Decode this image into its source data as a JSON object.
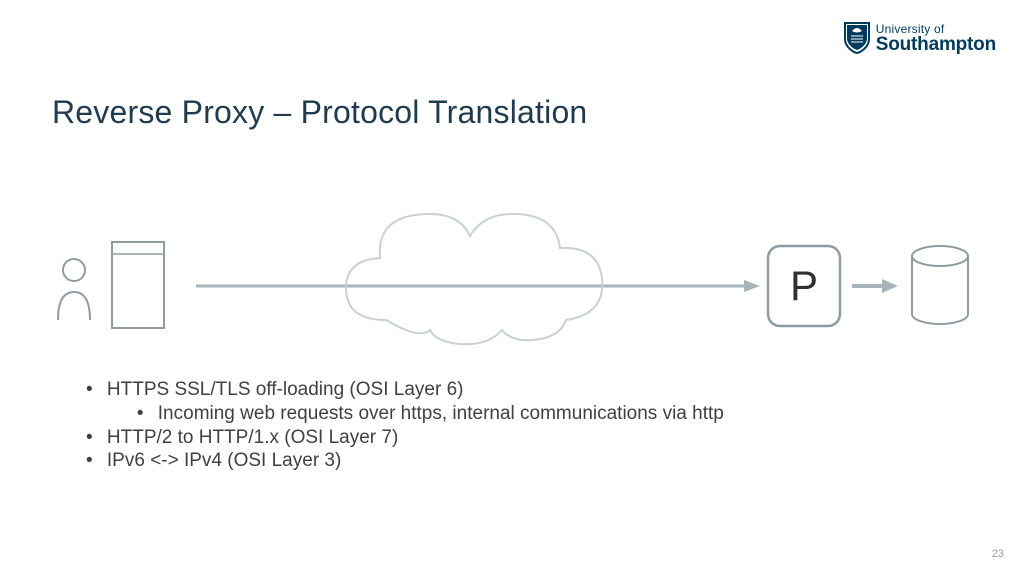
{
  "logo": {
    "line1": "University of",
    "line2": "Southampton"
  },
  "title": "Reverse Proxy – Protocol Translation",
  "diagram": {
    "proxy_label": "P"
  },
  "bullets": {
    "b1": "HTTPS  SSL/TLS off-loading (OSI Layer 6)",
    "b1a": "Incoming web requests over https, internal communications via http",
    "b2": "HTTP/2 to HTTP/1.x (OSI Layer 7)",
    "b3": "IPv6 <-> IPv4 (OSI Layer 3)"
  },
  "page_number": "23",
  "colors": {
    "title": "#1f3b4d",
    "stroke": "#a7b4b9",
    "brand": "#003b5c"
  }
}
